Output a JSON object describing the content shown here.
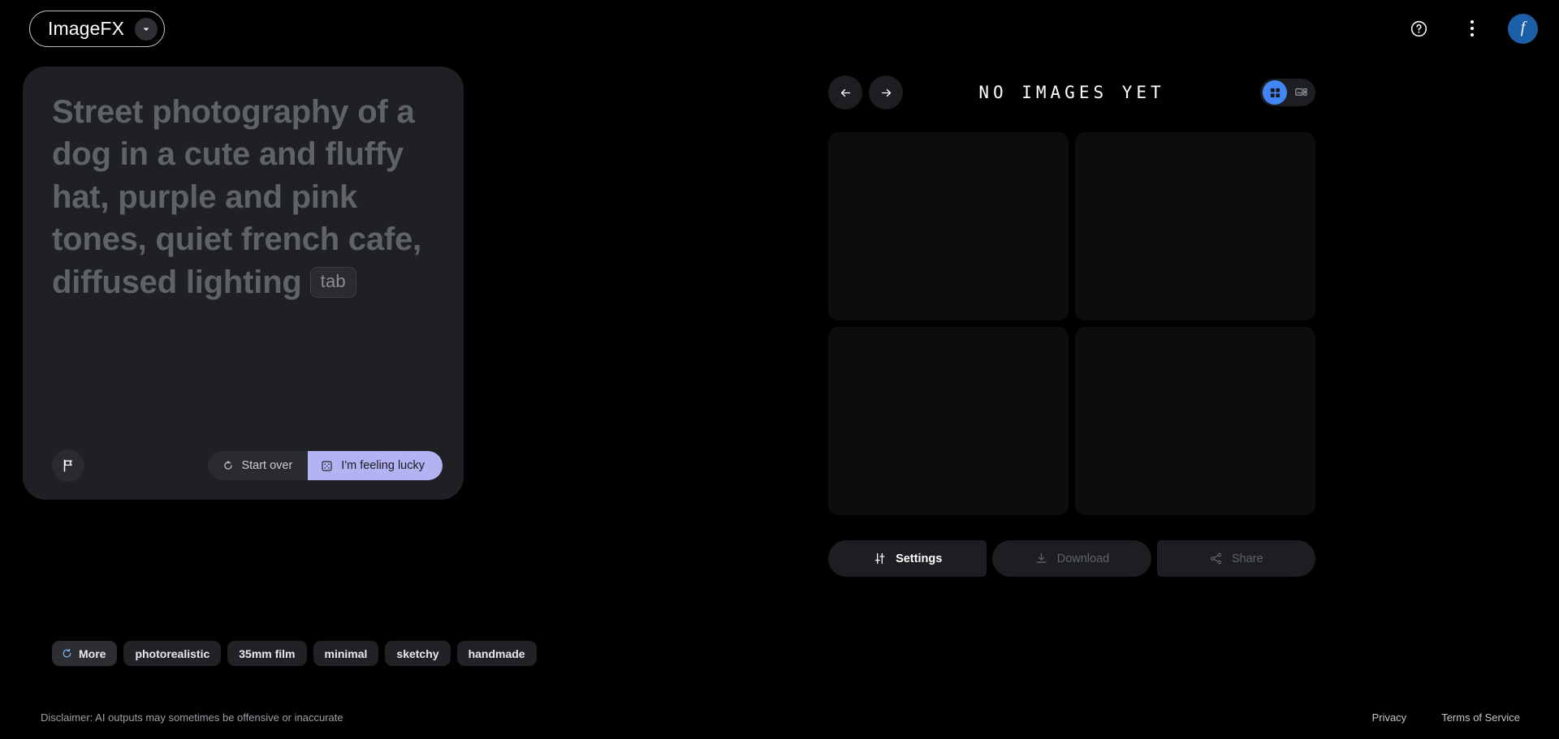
{
  "app": {
    "brand": "ImageFX",
    "brand_chevron_icon": "chevron-down-icon"
  },
  "topbar": {
    "help_icon": "help-circle-icon",
    "menu_icon": "more-vertical-icon",
    "avatar_initial": "f",
    "avatar_color": "#1a5fa8"
  },
  "prompt": {
    "text": "Street photography of a dog in a cute and fluffy hat, purple and pink tones, quiet french cafe, diffused lighting",
    "tab_hint": "tab",
    "flag_icon": "flag-icon",
    "start_over_label": "Start over",
    "start_over_icon": "refresh-icon",
    "lucky_label": "I'm feeling lucky",
    "lucky_icon": "dice-icon",
    "lucky_color": "#b3b2f2"
  },
  "chips": [
    {
      "label": "More",
      "icon": "refresh-icon",
      "highlighted": true
    },
    {
      "label": "photorealistic",
      "icon": "",
      "highlighted": false
    },
    {
      "label": "35mm film",
      "icon": "",
      "highlighted": false
    },
    {
      "label": "minimal",
      "icon": "",
      "highlighted": false
    },
    {
      "label": "sketchy",
      "icon": "",
      "highlighted": false
    },
    {
      "label": "handmade",
      "icon": "",
      "highlighted": false
    }
  ],
  "gallery": {
    "title": "NO IMAGES YET",
    "prev_icon": "arrow-left-icon",
    "next_icon": "arrow-right-icon",
    "view_grid_icon": "grid-view-icon",
    "view_detail_icon": "detail-view-icon",
    "active_view": "grid",
    "active_view_color": "#4285f4",
    "tiles": [
      {
        "state": "empty"
      },
      {
        "state": "empty"
      },
      {
        "state": "empty"
      },
      {
        "state": "empty"
      }
    ]
  },
  "actions": {
    "settings_label": "Settings",
    "settings_icon": "tune-icon",
    "download_label": "Download",
    "download_icon": "download-icon",
    "share_label": "Share",
    "share_icon": "share-icon"
  },
  "footer": {
    "disclaimer": "Disclaimer: AI outputs may sometimes be offensive or inaccurate",
    "privacy": "Privacy",
    "terms": "Terms of Service"
  }
}
